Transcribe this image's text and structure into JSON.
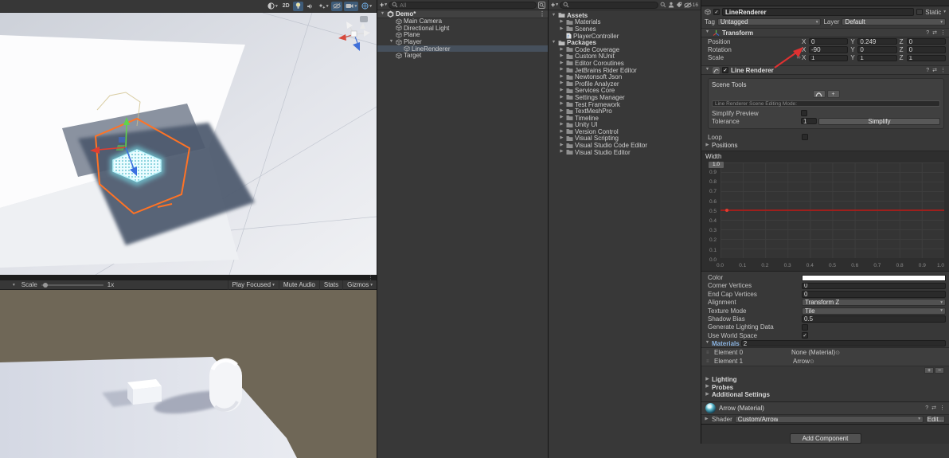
{
  "glyphs": {
    "dropdown": "▾",
    "menu": "⋮",
    "help": "?",
    "presets": "⇄",
    "plus": "+",
    "minus": "−",
    "check": "✓",
    "picker": "⊙",
    "drag": "≡",
    "fold_open": "▼",
    "fold_closed": "▶",
    "link": "∞",
    "label_2d": "2D"
  },
  "colors": {
    "selection_orange": "#ff7325",
    "gizmo_green": "#5fd34d",
    "gizmo_red": "#e03e31",
    "gizmo_blue": "#3a6fe0",
    "arrow_cyan": "#8df2ff",
    "curve_red": "#b92b20",
    "accent_blue": "#8ab3e0",
    "selected_row": "#46505c"
  },
  "scene_view": {
    "toolbar_2d": "2D"
  },
  "game_view": {
    "toolbar": {
      "scale_label": "Scale",
      "scale_value": "1x",
      "play_focused": "Play Focused",
      "mute_audio": "Mute Audio",
      "stats": "Stats",
      "gizmos": "Gizmos"
    }
  },
  "hierarchy": {
    "search_placeholder": "All",
    "scene_name": "Demo*",
    "items": [
      {
        "label": "Main Camera",
        "indent": 1
      },
      {
        "label": "Directional Light",
        "indent": 1
      },
      {
        "label": "Plane",
        "indent": 1
      },
      {
        "label": "Player",
        "indent": 1,
        "fold": "open"
      },
      {
        "label": "LineRenderer",
        "indent": 2,
        "selected": true
      },
      {
        "label": "Target",
        "indent": 1
      }
    ]
  },
  "project": {
    "search_placeholder": "",
    "hidden_count": "16",
    "items": [
      {
        "label": "Assets",
        "icon": "folder-open",
        "fold": "open",
        "indent": 0,
        "bold": true
      },
      {
        "label": "Materials",
        "icon": "folder",
        "fold": "closed",
        "indent": 1
      },
      {
        "label": "Scenes",
        "icon": "folder",
        "fold": "closed",
        "indent": 1
      },
      {
        "label": "PlayerController",
        "icon": "script",
        "indent": 1
      },
      {
        "label": "Packages",
        "icon": "folder-open",
        "fold": "open",
        "indent": 0,
        "bold": true
      },
      {
        "label": "Code Coverage",
        "icon": "folder",
        "fold": "closed",
        "indent": 1
      },
      {
        "label": "Custom NUnit",
        "icon": "folder",
        "fold": "closed",
        "indent": 1
      },
      {
        "label": "Editor Coroutines",
        "icon": "folder",
        "fold": "closed",
        "indent": 1
      },
      {
        "label": "JetBrains Rider Editor",
        "icon": "folder",
        "fold": "closed",
        "indent": 1
      },
      {
        "label": "Newtonsoft Json",
        "icon": "folder",
        "fold": "closed",
        "indent": 1
      },
      {
        "label": "Profile Analyzer",
        "icon": "folder",
        "fold": "closed",
        "indent": 1
      },
      {
        "label": "Services Core",
        "icon": "folder",
        "fold": "closed",
        "indent": 1
      },
      {
        "label": "Settings Manager",
        "icon": "folder",
        "fold": "closed",
        "indent": 1
      },
      {
        "label": "Test Framework",
        "icon": "folder",
        "fold": "closed",
        "indent": 1
      },
      {
        "label": "TextMeshPro",
        "icon": "folder",
        "fold": "closed",
        "indent": 1
      },
      {
        "label": "Timeline",
        "icon": "folder",
        "fold": "closed",
        "indent": 1
      },
      {
        "label": "Unity UI",
        "icon": "folder",
        "fold": "closed",
        "indent": 1
      },
      {
        "label": "Version Control",
        "icon": "folder",
        "fold": "closed",
        "indent": 1
      },
      {
        "label": "Visual Scripting",
        "icon": "folder",
        "fold": "closed",
        "indent": 1
      },
      {
        "label": "Visual Studio Code Editor",
        "icon": "folder",
        "fold": "closed",
        "indent": 1
      },
      {
        "label": "Visual Studio Editor",
        "icon": "folder",
        "fold": "closed",
        "indent": 1
      }
    ]
  },
  "inspector": {
    "header": {
      "name": "LineRenderer",
      "static_label": "Static",
      "tag_label": "Tag",
      "tag_value": "Untagged",
      "layer_label": "Layer",
      "layer_value": "Default"
    },
    "transform": {
      "title": "Transform",
      "axes": [
        "X",
        "Y",
        "Z"
      ],
      "rows": [
        {
          "label": "Position",
          "values": [
            "0",
            "0.249",
            "0"
          ]
        },
        {
          "label": "Rotation",
          "values": [
            "-90",
            "0",
            "0"
          ]
        },
        {
          "label": "Scale",
          "values": [
            "1",
            "1",
            "1"
          ],
          "link": true
        }
      ]
    },
    "line_renderer": {
      "title": "Line Renderer",
      "scene_tools": {
        "title": "Scene Tools",
        "edit_mode_label": "Line Renderer Scene Editing Mode:",
        "simplify_preview_label": "Simplify Preview",
        "simplify_preview_checked": false,
        "tolerance_label": "Tolerance",
        "tolerance_value": "1",
        "simplify_button": "Simplify"
      },
      "loop_label": "Loop",
      "loop_checked": false,
      "positions_label": "Positions",
      "width_curve": {
        "label": "Width",
        "value": "1.0",
        "curve_y": 0.5,
        "y_ticks": [
          "0.9",
          "0.8",
          "0.7",
          "0.6",
          "0.5",
          "0.4",
          "0.3",
          "0.2",
          "0.1",
          "0.0"
        ],
        "x_ticks": [
          "0.0",
          "0.1",
          "0.2",
          "0.3",
          "0.4",
          "0.5",
          "0.6",
          "0.7",
          "0.8",
          "0.9",
          "1.0"
        ]
      },
      "rows": [
        {
          "label": "Color",
          "type": "gradient"
        },
        {
          "label": "Corner Vertices",
          "type": "field",
          "value": "0"
        },
        {
          "label": "End Cap Vertices",
          "type": "field",
          "value": "0"
        },
        {
          "label": "Alignment",
          "type": "dropdown",
          "value": "Transform Z"
        },
        {
          "label": "Texture Mode",
          "type": "dropdown",
          "value": "Tile"
        },
        {
          "label": "Shadow Bias",
          "type": "field",
          "value": "0.5"
        },
        {
          "label": "Generate Lighting Data",
          "type": "checkbox",
          "checked": false
        },
        {
          "label": "Use World Space",
          "type": "checkbox",
          "checked": true
        }
      ],
      "materials": {
        "title": "Materials",
        "count": "2",
        "elements": [
          {
            "label": "Element 0",
            "value": "None (Material)",
            "icon": false
          },
          {
            "label": "Element 1",
            "value": "Arrow",
            "icon": true
          }
        ]
      },
      "foldouts": [
        "Lighting",
        "Probes",
        "Additional Settings"
      ]
    },
    "material": {
      "title": "Arrow (Material)",
      "shader_label": "Shader",
      "shader_value": "Custom/Arrow",
      "edit_button": "Edit..."
    },
    "add_component_label": "Add Component"
  }
}
